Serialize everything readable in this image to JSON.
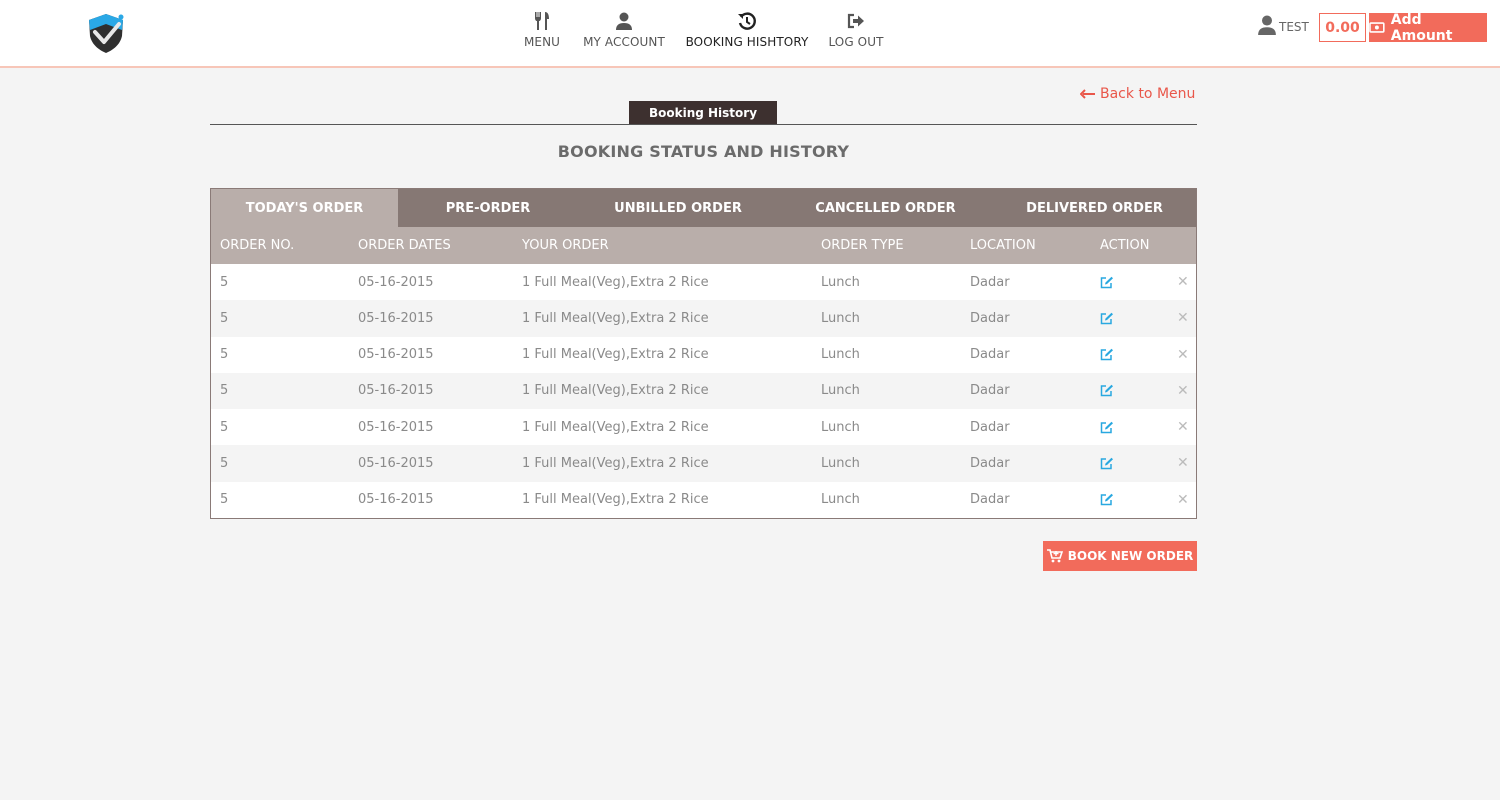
{
  "header": {
    "nav": [
      {
        "label": "MENU",
        "icon": "fork-knife-icon"
      },
      {
        "label": "MY ACCOUNT",
        "icon": "user-icon"
      },
      {
        "label": "BOOKING HISHTORY",
        "icon": "history-icon"
      },
      {
        "label": "LOG OUT",
        "icon": "logout-icon"
      }
    ],
    "username": "TEST",
    "balance": "0.00",
    "add_amount_label": "Add Amount"
  },
  "content": {
    "back_link": "Back to Menu",
    "section_tag": "Booking History",
    "title": "BOOKING STATUS AND HISTORY",
    "tabs": [
      "TODAY'S ORDER",
      "PRE-ORDER",
      "UNBILLED ORDER",
      "CANCELLED ORDER",
      "DELIVERED ORDER"
    ],
    "active_tab": "TODAY'S ORDER",
    "columns": [
      "ORDER NO.",
      "ORDER DATES",
      "YOUR ORDER",
      "ORDER TYPE",
      "LOCATION",
      "ACTION"
    ],
    "rows": [
      {
        "no": "5",
        "date": "05-16-2015",
        "order": "1 Full Meal(Veg),Extra 2 Rice",
        "type": "Lunch",
        "location": "Dadar"
      },
      {
        "no": "5",
        "date": "05-16-2015",
        "order": "1 Full Meal(Veg),Extra 2 Rice",
        "type": "Lunch",
        "location": "Dadar"
      },
      {
        "no": "5",
        "date": "05-16-2015",
        "order": "1 Full Meal(Veg),Extra 2 Rice",
        "type": "Lunch",
        "location": "Dadar"
      },
      {
        "no": "5",
        "date": "05-16-2015",
        "order": "1 Full Meal(Veg),Extra 2 Rice",
        "type": "Lunch",
        "location": "Dadar"
      },
      {
        "no": "5",
        "date": "05-16-2015",
        "order": "1 Full Meal(Veg),Extra 2 Rice",
        "type": "Lunch",
        "location": "Dadar"
      },
      {
        "no": "5",
        "date": "05-16-2015",
        "order": "1 Full Meal(Veg),Extra 2 Rice",
        "type": "Lunch",
        "location": "Dadar"
      },
      {
        "no": "5",
        "date": "05-16-2015",
        "order": "1 Full Meal(Veg),Extra 2 Rice",
        "type": "Lunch",
        "location": "Dadar"
      }
    ],
    "book_button": "BOOK NEW ORDER"
  },
  "colors": {
    "accent": "#f26b5b",
    "tab_bar": "#867874",
    "tab_active": "#b9aeaa",
    "section_tag": "#3d302f",
    "edit_icon": "#29a8e0"
  }
}
